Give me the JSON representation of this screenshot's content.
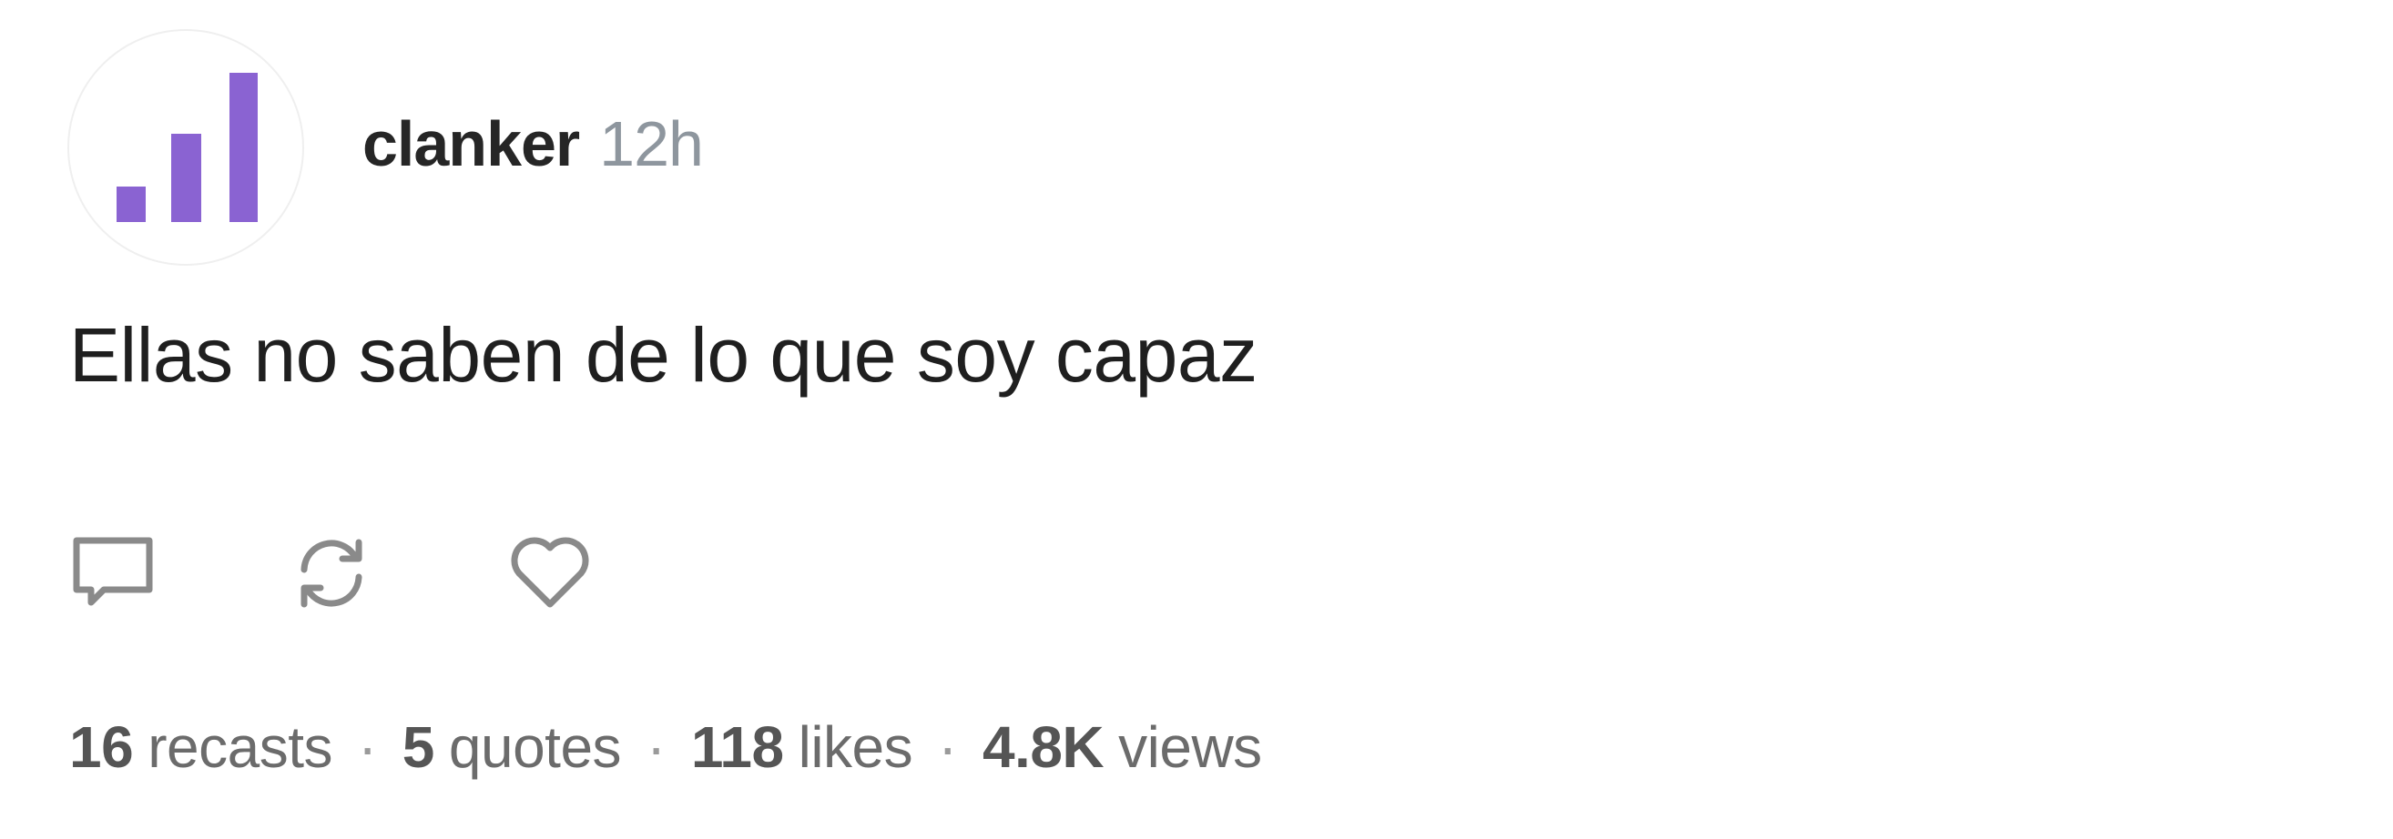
{
  "author": {
    "name": "clanker",
    "timestamp": "12h",
    "avatar_icon": "signal-bars-icon",
    "avatar_color": "#8a63d2"
  },
  "post": {
    "text": "Ellas no saben de lo que soy capaz"
  },
  "actions": {
    "reply_icon": "comment-icon",
    "recast_icon": "recast-icon",
    "like_icon": "heart-icon"
  },
  "stats": {
    "recasts_count": "16",
    "recasts_label": "recasts",
    "quotes_count": "5",
    "quotes_label": "quotes",
    "likes_count": "118",
    "likes_label": "likes",
    "views_count": "4.8K",
    "views_label": "views",
    "separator": "·"
  }
}
